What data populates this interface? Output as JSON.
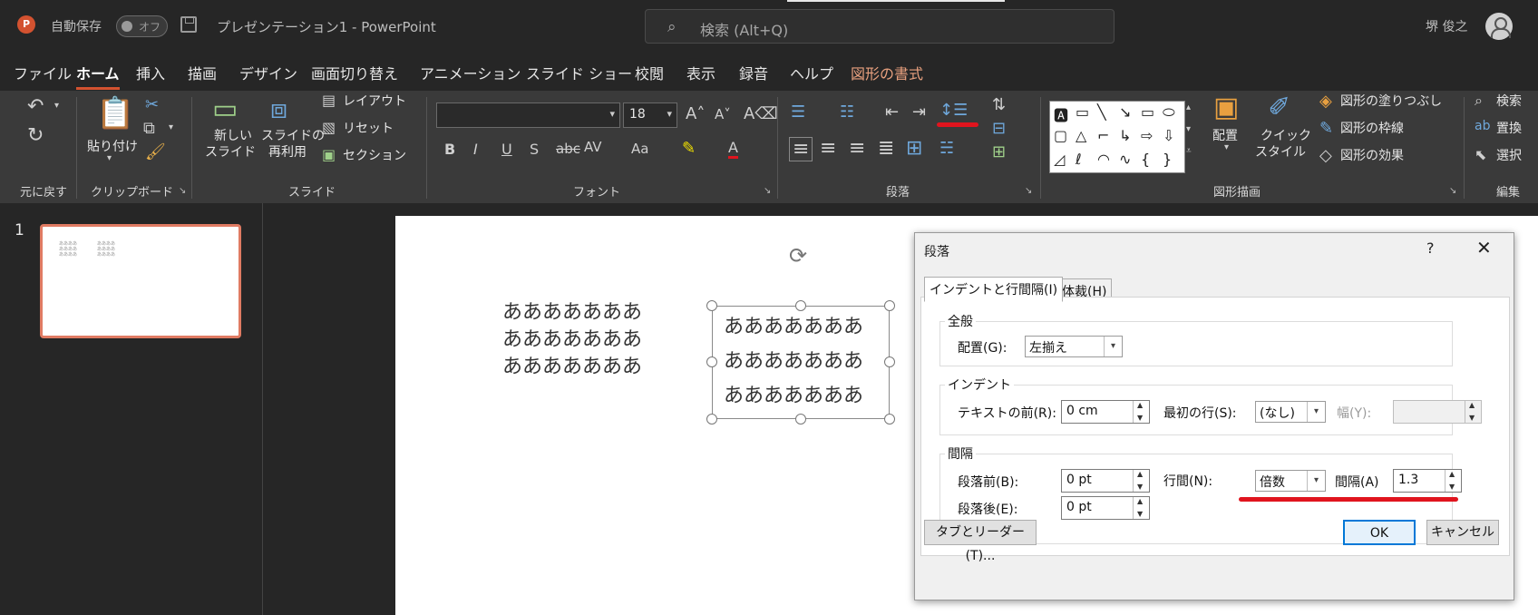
{
  "titlebar": {
    "app_icon_letter": "P",
    "autosave_label": "自動保存",
    "toggle_label": "オフ",
    "doc_title": "プレゼンテーション1  -  PowerPoint",
    "search_placeholder": "検索 (Alt+Q)",
    "user_name": "堺 俊之"
  },
  "menu": {
    "items": [
      "ファイル",
      "ホーム",
      "挿入",
      "描画",
      "デザイン",
      "画面切り替え",
      "アニメーション",
      "スライド ショー",
      "校閲",
      "表示",
      "録音",
      "ヘルプ",
      "図形の書式"
    ],
    "active": "ホーム"
  },
  "ribbon": {
    "undo_group": "元に戻す",
    "clipboard": {
      "paste": "貼り付け",
      "label": "クリップボード"
    },
    "slides": {
      "new_slide_1": "新しい",
      "new_slide_2": "スライド",
      "reuse_1": "スライドの",
      "reuse_2": "再利用",
      "layout": "レイアウト",
      "reset": "リセット",
      "section": "セクション",
      "label": "スライド"
    },
    "font": {
      "font_name": "",
      "font_size": "18",
      "label": "フォント"
    },
    "paragraph": {
      "label": "段落"
    },
    "drawing": {
      "arrange": "配置",
      "quick_1": "クイック",
      "quick_2": "スタイル",
      "fill": "図形の塗りつぶし",
      "outline": "図形の枠線",
      "effect": "図形の効果",
      "label": "図形描画"
    },
    "editing": {
      "find": "検索",
      "replace": "置換",
      "select": "選択",
      "label": "編集"
    },
    "accent_color": "#e0141e"
  },
  "slides_panel": {
    "slide_number": "1"
  },
  "slide": {
    "text_line": "あああああああ"
  },
  "dialog": {
    "title": "段落",
    "help": "?",
    "close": "✕",
    "tabs": [
      "インデントと行間隔(I)",
      "体裁(H)"
    ],
    "general": {
      "legend": "全般",
      "alignment_label": "配置(G):",
      "alignment_value": "左揃え"
    },
    "indent": {
      "legend": "インデント",
      "before_text_label": "テキストの前(R):",
      "before_text_value": "0 cm",
      "first_line_label": "最初の行(S):",
      "first_line_value": "(なし)",
      "width_label": "幅(Y):",
      "width_value": ""
    },
    "spacing": {
      "legend": "間隔",
      "before_label": "段落前(B):",
      "before_value": "0 pt",
      "after_label": "段落後(E):",
      "after_value": "0 pt",
      "line_spacing_label": "行間(N):",
      "line_spacing_value": "倍数",
      "at_label": "間隔(A)",
      "at_value": "1.3"
    },
    "tabs_button": "タブとリーダー(T)...",
    "ok": "OK",
    "cancel": "キャンセル"
  }
}
